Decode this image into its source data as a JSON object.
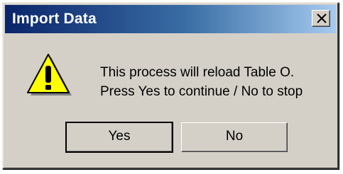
{
  "window": {
    "title": "Import Data",
    "close_icon": "close-x-icon"
  },
  "icon": {
    "name": "warning-icon",
    "glyph": "!",
    "color": "#ffff00"
  },
  "message": {
    "line1": "This process will reload Table O.",
    "line2": "Press Yes to continue / No to stop"
  },
  "buttons": {
    "yes_label": "Yes",
    "no_label": "No"
  },
  "colors": {
    "titlebar_start": "#0a246a",
    "titlebar_end": "#a6caf0",
    "dialog_face": "#d4d0c8"
  }
}
